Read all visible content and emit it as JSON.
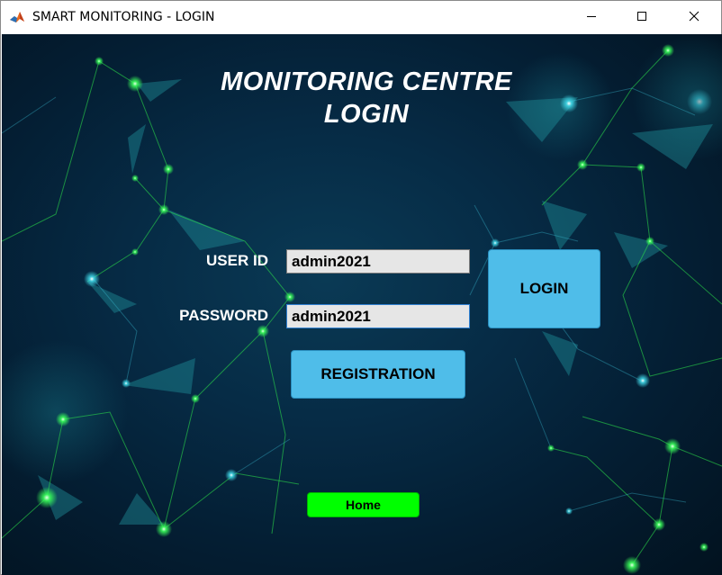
{
  "window": {
    "title": "SMART MONITORING - LOGIN",
    "icon": "matlab-icon",
    "controls": [
      "minimize-icon",
      "maximize-icon",
      "close-icon"
    ]
  },
  "heading": {
    "line1": "MONITORING CENTRE",
    "line2": "LOGIN"
  },
  "form": {
    "user_label": "USER ID",
    "user_value": "admin2021",
    "password_label": "PASSWORD",
    "password_value": "admin2021"
  },
  "buttons": {
    "login": "LOGIN",
    "registration": "REGISTRATION",
    "home": "Home"
  },
  "colors": {
    "button_blue": "#4fbde9",
    "home_green": "#00ff00",
    "background_dark": "#041e33",
    "network_green": "#39ff5a",
    "network_cyan": "#3fd6e6"
  }
}
